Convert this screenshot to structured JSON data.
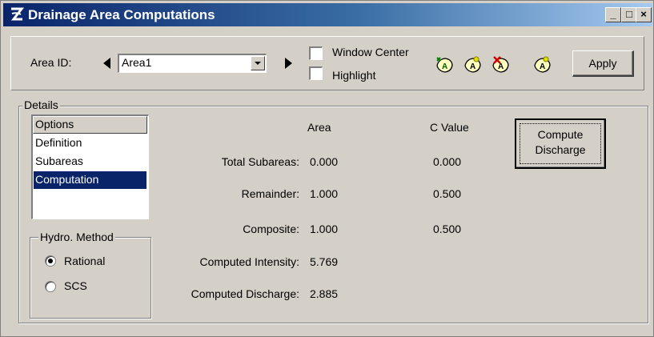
{
  "window": {
    "title": "Drainage Area Computations",
    "controls": {
      "minimize": "_",
      "maximize": "□",
      "close": "×"
    }
  },
  "toolbar": {
    "area_id_label": "Area ID:",
    "area_id_value": "Area1",
    "window_center_label": "Window Center",
    "window_center_checked": false,
    "highlight_label": "Highlight",
    "highlight_checked": false,
    "tool_icons": [
      "add-area-icon",
      "identify-area-icon",
      "delete-area-icon",
      "modify-area-icon"
    ],
    "tool_icon_glyph": "A",
    "apply_label": "Apply"
  },
  "details": {
    "group_label": "Details",
    "options_header": "Options",
    "options": [
      "Definition",
      "Subareas",
      "Computation"
    ],
    "selected_option": "Computation",
    "hydro_method": {
      "label": "Hydro. Method",
      "options": [
        "Rational",
        "SCS"
      ],
      "selected": "Rational"
    },
    "columns": {
      "area": "Area",
      "c_value": "C Value"
    },
    "rows": {
      "total_subareas": {
        "label": "Total Subareas:",
        "area": "0.000",
        "c_value": "0.000"
      },
      "remainder": {
        "label": "Remainder:",
        "area": "1.000",
        "c_value": "0.500"
      },
      "composite": {
        "label": "Composite:",
        "area": "1.000",
        "c_value": "0.500"
      },
      "computed_intensity": {
        "label": "Computed Intensity:",
        "value": "5.769"
      },
      "computed_discharge": {
        "label": "Computed Discharge:",
        "value": "2.885"
      }
    },
    "compute_button": {
      "line1": "Compute",
      "line2": "Discharge"
    }
  },
  "colors": {
    "title_bar": "#0a246a",
    "title_bar_gradient_end": "#a6caf0",
    "face": "#d4d0c8",
    "selection": "#0a246a"
  }
}
